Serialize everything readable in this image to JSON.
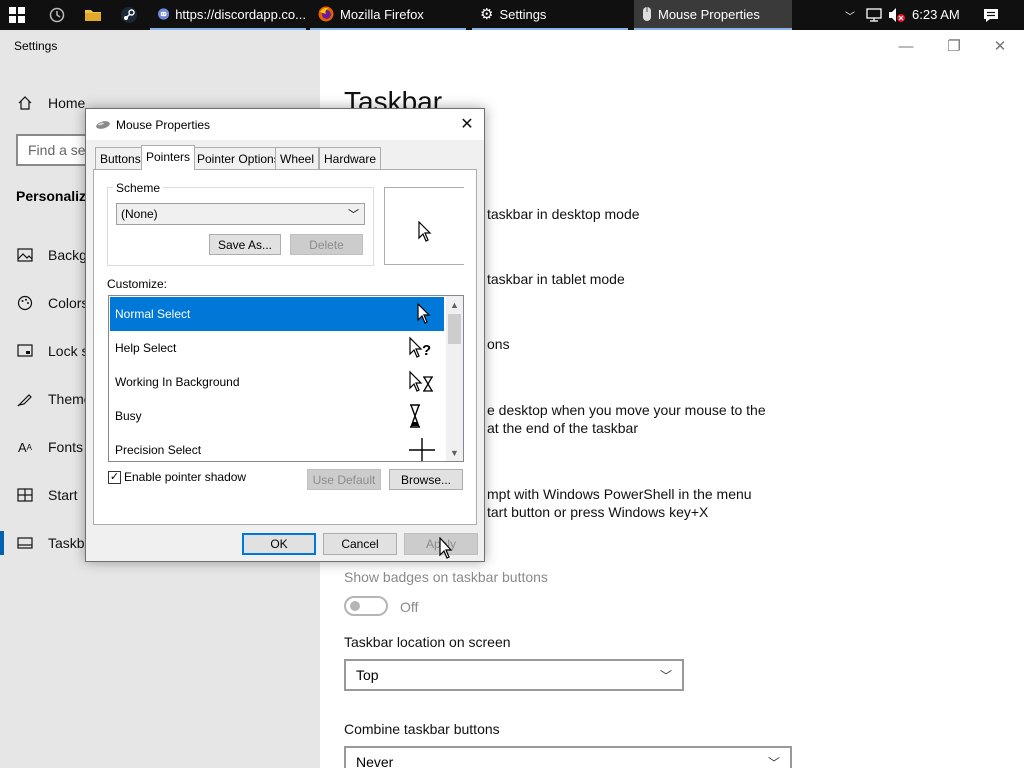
{
  "taskbar": {
    "tasks": [
      {
        "label": "https://discordapp.co...",
        "icon": "discord-icon"
      },
      {
        "label": "Mozilla Firefox",
        "icon": "firefox-icon"
      },
      {
        "label": "Settings",
        "icon": "gear-icon"
      },
      {
        "label": "Mouse Properties",
        "icon": "mouse-icon"
      }
    ],
    "clock": "6:23 AM"
  },
  "settings": {
    "title": "Settings",
    "sidebar": {
      "home": "Home",
      "search_placeholder": "Find a set",
      "section": "Personaliza",
      "items": [
        {
          "label": "Backgr",
          "icon": "picture-icon"
        },
        {
          "label": "Colors",
          "icon": "palette-icon"
        },
        {
          "label": "Lock s",
          "icon": "lock-screen-icon"
        },
        {
          "label": "Theme",
          "icon": "themes-icon"
        },
        {
          "label": "Fonts",
          "icon": "fonts-icon"
        },
        {
          "label": "Start",
          "icon": "start-icon"
        },
        {
          "label": "Taskba",
          "icon": "taskbar-icon"
        }
      ]
    },
    "content": {
      "page_title": "Taskbar",
      "lines": [
        "taskbar in desktop mode",
        "taskbar in tablet mode",
        "ons",
        "e desktop when you move your mouse to the",
        "at the end of the taskbar",
        "mpt with Windows PowerShell in the menu",
        "tart button or press Windows key+X"
      ],
      "badges_label": "Show badges on taskbar buttons",
      "badges_toggle": "Off",
      "location_label": "Taskbar location on screen",
      "location_value": "Top",
      "combine_label": "Combine taskbar buttons",
      "combine_value": "Never"
    }
  },
  "dialog": {
    "title": "Mouse Properties",
    "tabs": [
      "Buttons",
      "Pointers",
      "Pointer Options",
      "Wheel",
      "Hardware"
    ],
    "selected_tab": "Pointers",
    "scheme_label": "Scheme",
    "scheme_value": "(None)",
    "save_as": "Save As...",
    "delete": "Delete",
    "customize_label": "Customize:",
    "cursors": [
      {
        "label": "Normal Select",
        "icon": "arrow-cursor-icon"
      },
      {
        "label": "Help Select",
        "icon": "help-cursor-icon"
      },
      {
        "label": "Working In Background",
        "icon": "working-cursor-icon"
      },
      {
        "label": "Busy",
        "icon": "hourglass-cursor-icon"
      },
      {
        "label": "Precision Select",
        "icon": "crosshair-cursor-icon"
      }
    ],
    "shadow_label": "Enable pointer shadow",
    "shadow_checked": true,
    "use_default": "Use Default",
    "browse": "Browse...",
    "ok": "OK",
    "cancel": "Cancel",
    "apply": "Apply"
  }
}
